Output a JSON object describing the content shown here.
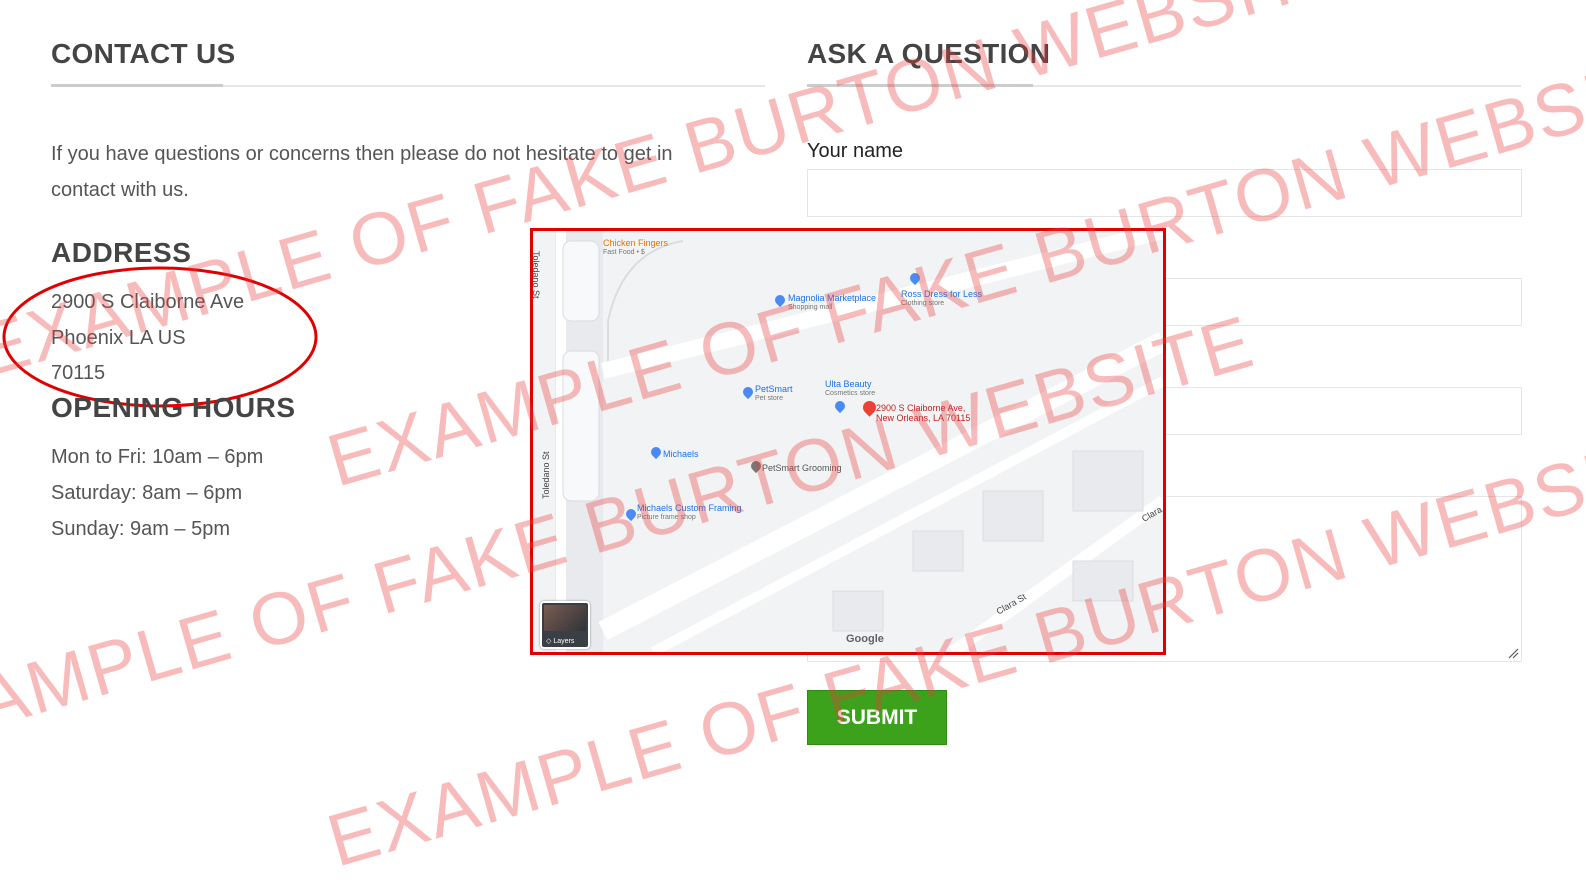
{
  "contact": {
    "title": "CONTACT US",
    "intro_line1": "If you have questions or concerns then please do not hesitate to get in",
    "intro_line2": "contact with us.",
    "address_title": "ADDRESS",
    "address_line1": "2900 S Claiborne Ave",
    "address_line2": "Phoenix LA US",
    "address_line3": "70115",
    "hours_title": "OPENING HOURS",
    "hours": [
      "Mon to Fri: 10am – 6pm",
      "Saturday: 8am – 6pm",
      "Sunday: 9am – 5pm"
    ]
  },
  "question": {
    "title": "ASK A QUESTION",
    "name_label": "Your name",
    "submit_label": "SUBMIT"
  },
  "map": {
    "streets": [
      "Toledano St",
      "Toledano St",
      "Clara St",
      "Clara"
    ],
    "pois": [
      {
        "name": "Chicken Fingers",
        "sub": "Fast Food • $"
      },
      {
        "name": "Magnolia Marketplace",
        "sub": "Shopping mall"
      },
      {
        "name": "Ross Dress for Less",
        "sub": "Clothing store"
      },
      {
        "name": "PetSmart",
        "sub": "Pet store"
      },
      {
        "name": "Ulta Beauty",
        "sub": "Cosmetics store"
      },
      {
        "name": "Michaels",
        "sub": ""
      },
      {
        "name": "PetSmart Grooming",
        "sub": ""
      },
      {
        "name": "Michaels Custom Framing",
        "sub": "Picture frame shop"
      }
    ],
    "marker_line1": "2900 S Claiborne Ave,",
    "marker_line2": "New Orleans, LA 70115",
    "layers_label": "Layers",
    "google_label": "Google"
  },
  "watermark": "EXAMPLE OF FAKE BURTON WEBSITE"
}
